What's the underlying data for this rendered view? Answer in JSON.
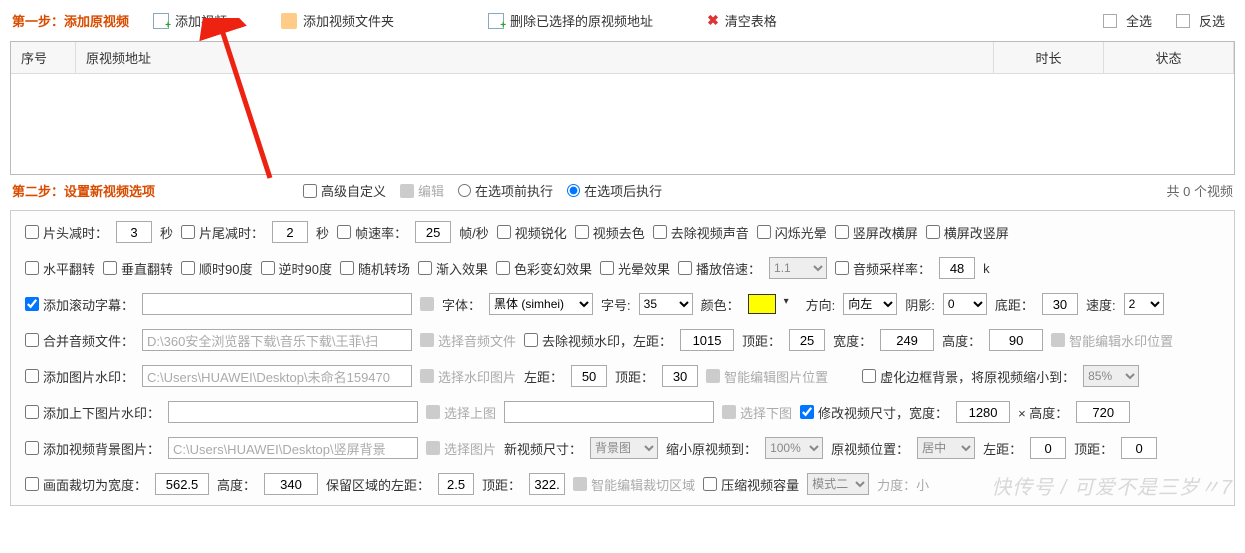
{
  "toolbar": {
    "step1": "第一步：添加原视频",
    "add_video": "添加视频",
    "add_folder": "添加视频文件夹",
    "del_selected": "删除已选择的原视频地址",
    "clear": "清空表格",
    "select_all": "全选",
    "invert": "反选"
  },
  "table": {
    "seq": "序号",
    "path": "原视频地址",
    "dur": "时长",
    "stat": "状态"
  },
  "bar2": {
    "step2": "第二步：设置新视频选项",
    "advanced": "高级自定义",
    "edit": "编辑",
    "before": "在选项前执行",
    "after": "在选项后执行",
    "count": "共 0 个视频"
  },
  "r1": {
    "head_trim": "片头减时：",
    "head_val": "3",
    "sec1": "秒",
    "tail_trim": "片尾减时：",
    "tail_val": "2",
    "sec2": "秒",
    "fps": "帧速率：",
    "fps_val": "25",
    "fps_unit": "帧/秒",
    "sharpen": "视频锐化",
    "desat": "视频去色",
    "mute": "去除视频声音",
    "flash": "闪烁光晕",
    "v2h": "竖屏改横屏",
    "h2v": "横屏改竖屏"
  },
  "r2": {
    "hflip": "水平翻转",
    "vflip": "垂直翻转",
    "cw": "顺时90度",
    "ccw": "逆时90度",
    "rand": "随机转场",
    "fade": "渐入效果",
    "color": "色彩变幻效果",
    "halo": "光晕效果",
    "speed": "播放倍速：",
    "speed_val": "1.1",
    "asr": "音频采样率：",
    "asr_val": "48",
    "k": "k"
  },
  "r3": {
    "scroll": "添加滚动字幕：",
    "font": "字体：",
    "font_val": "黑体 (simhei)",
    "size": "字号:",
    "size_val": "35",
    "color_l": "颜色：",
    "dir": "方向:",
    "dir_val": "向左",
    "shadow": "阴影:",
    "shadow_val": "0",
    "bottom": "底距：",
    "bottom_val": "30",
    "spd": "速度:",
    "spd_val": "2"
  },
  "r4": {
    "merge": "合并音频文件：",
    "merge_path": "D:\\360安全浏览器下载\\音乐下载\\王菲\\扫",
    "pick_audio": "选择音频文件",
    "rm_wm": "去除视频水印，左距：",
    "l": "1015",
    "top_l": "顶距：",
    "t": "25",
    "w_l": "宽度：",
    "w": "249",
    "h_l": "高度：",
    "h": "90",
    "smart": "智能编辑水印位置"
  },
  "r5": {
    "img_wm": "添加图片水印：",
    "path": "C:\\Users\\HUAWEI\\Desktop\\未命名159470",
    "pick": "选择水印图片",
    "left": "左距：",
    "l": "50",
    "top": "顶距：",
    "t": "30",
    "smart": "智能编辑图片位置",
    "border": "虚化边框背景，将原视频缩小到：",
    "pct": "85%"
  },
  "r6": {
    "tb_wm": "添加上下图片水印：",
    "pick_top": "选择上图",
    "pick_bot": "选择下图",
    "resize": "修改视频尺寸，宽度：",
    "w": "1280",
    "x": "× 高度：",
    "h": "720"
  },
  "r7": {
    "bg": "添加视频背景图片：",
    "path": "C:\\Users\\HUAWEI\\Desktop\\竖屏背景",
    "pick": "选择图片",
    "newsize": "新视频尺寸：",
    "bg_opt": "背景图",
    "shrink": "缩小原视频到：",
    "pct": "100%",
    "pos": "原视频位置：",
    "pos_val": "居中",
    "left": "左距：",
    "l": "0",
    "top": "顶距：",
    "t": "0"
  },
  "r8": {
    "crop": "画面裁切为宽度：",
    "w": "562.5",
    "h_l": "高度：",
    "h": "340",
    "keep": "保留区域的左距：",
    "l": "2.5",
    "top": "顶距：",
    "t": "322.",
    "smart": "智能编辑裁切区域",
    "compress": "压缩视频容量",
    "mode": "模式二",
    "power": "力度：小"
  },
  "watermark": "快传号 / 可爱不是三岁〃7"
}
